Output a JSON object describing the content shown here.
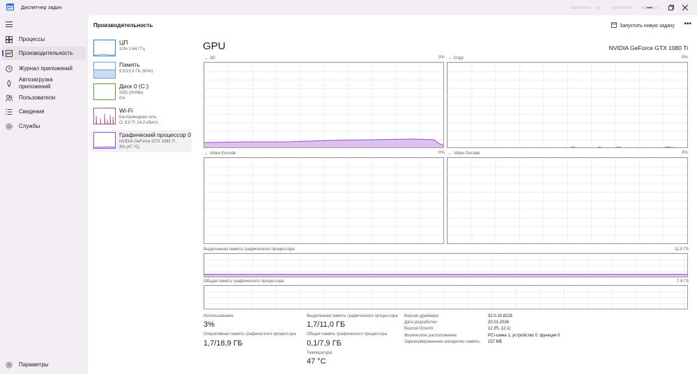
{
  "window": {
    "title": "Диспетчер задач"
  },
  "nav": {
    "items": [
      {
        "label": "Процессы",
        "icon": "processes-icon"
      },
      {
        "label": "Производительность",
        "icon": "performance-icon",
        "active": true
      },
      {
        "label": "Журнал приложений",
        "icon": "app-history-icon"
      },
      {
        "label": "Автозагрузка приложений",
        "icon": "startup-icon"
      },
      {
        "label": "Пользователи",
        "icon": "users-icon"
      },
      {
        "label": "Сведения",
        "icon": "details-icon"
      },
      {
        "label": "Службы",
        "icon": "services-icon"
      }
    ],
    "settings": "Параметры"
  },
  "header": {
    "title": "Производительность",
    "run_task": "Запустить новую задачу"
  },
  "perf_list": [
    {
      "name": "ЦП",
      "sub1": "10%  1,64 ГГц",
      "sub2": ""
    },
    {
      "name": "Память",
      "sub1": "9,5/15,9 ГБ (60%)",
      "sub2": ""
    },
    {
      "name": "Диск 0 (C:)",
      "sub1": "SSD (NVMe)",
      "sub2": "0%"
    },
    {
      "name": "Wi-Fi",
      "sub1": "Беспроводная сеть",
      "sub2": "О: 8,0  П: 24,0 кбит/с"
    },
    {
      "name": "Графический процессор 0",
      "sub1": "NVIDIA GeForce GTX 1080 Ti",
      "sub2": "3% (47 °C)"
    }
  ],
  "gpu": {
    "title": "GPU",
    "model": "NVIDIA GeForce GTX 1080 Ti",
    "engines": [
      {
        "label": "3D",
        "pct": "3%"
      },
      {
        "label": "Copy",
        "pct": "0%"
      },
      {
        "label": "Video Encode",
        "pct": "0%"
      },
      {
        "label": "Video Decode",
        "pct": "0%"
      }
    ],
    "dedicated_mem_label": "Выделенная память графического процессора",
    "dedicated_mem_max": "11,0 ГБ",
    "shared_mem_label": "Общая память графического процессора",
    "shared_mem_max": "7,9 ГБ"
  },
  "stats": {
    "usage_label": "Использование",
    "usage_value": "3%",
    "ded_label": "Выделенная память графического процессора",
    "ded_value": "1,7/11,0 ГБ",
    "ram_label": "Оперативная память графического процессора",
    "ram_value": "1,7/18,9 ГБ",
    "shared_label": "Общая память графического процессора",
    "shared_value": "0,1/7,9 ГБ",
    "temp_label": "Температура",
    "temp_value": "47 °C"
  },
  "props": [
    {
      "label": "Версия драйвера:",
      "value": "32.0.15.8228"
    },
    {
      "label": "Дата разработки:",
      "value": "20.01.2026"
    },
    {
      "label": "Версия DirectX:",
      "value": "12 (FL 12.1)"
    },
    {
      "label": "Физическое расположение:",
      "value": "PCI-шина 1, устройство 0, функция 0"
    },
    {
      "label": "Зарезервированная аппаратно память:",
      "value": "157 МБ"
    }
  ],
  "colors": {
    "accent": "#5a4fb8",
    "gpu_line": "#9b4fd0",
    "gpu_fill": "#dcc3ef"
  }
}
